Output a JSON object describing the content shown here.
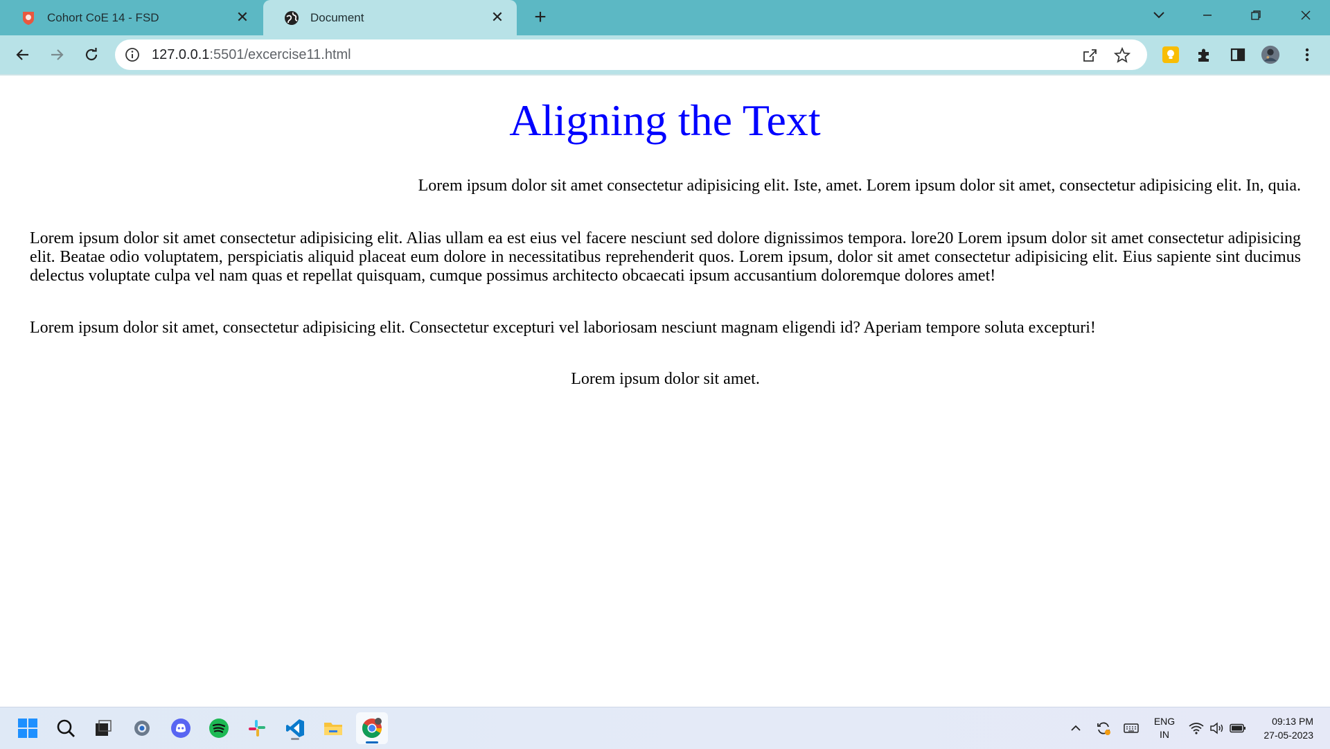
{
  "browser": {
    "tabs": [
      {
        "title": "Cohort CoE 14 - FSD",
        "favicon": "shield-favicon-icon",
        "active": false
      },
      {
        "title": "Document",
        "favicon": "globe-favicon-icon",
        "active": true
      }
    ],
    "new_tab_symbol": "+",
    "address": {
      "host": "127.0.0.1",
      "path": ":5501/excercise11.html"
    },
    "colors": {
      "tabstrip": "#5cb8c4",
      "toolbar": "#b8e2e7"
    }
  },
  "page": {
    "heading": "Aligning the Text",
    "heading_color": "#0000ff",
    "paragraphs": [
      {
        "align": "right",
        "text": "Lorem ipsum dolor sit amet consectetur adipisicing elit. Iste, amet. Lorem ipsum dolor sit amet, consectetur adipisicing elit. In, quia."
      },
      {
        "align": "justify",
        "text": "Lorem ipsum dolor sit amet consectetur adipisicing elit. Alias ullam ea est eius vel facere nesciunt sed dolore dignissimos tempora. lore20 Lorem ipsum dolor sit amet consectetur adipisicing elit. Beatae odio voluptatem, perspiciatis aliquid placeat eum dolore in necessitatibus reprehenderit quos. Lorem ipsum, dolor sit amet consectetur adipisicing elit. Eius sapiente sint ducimus delectus voluptate culpa vel nam quas et repellat quisquam, cumque possimus architecto obcaecati ipsum accusantium doloremque dolores amet!"
      },
      {
        "align": "left",
        "text": "Lorem ipsum dolor sit amet, consectetur adipisicing elit. Consectetur excepturi vel laboriosam nesciunt magnam eligendi id? Aperiam tempore soluta excepturi!"
      },
      {
        "align": "center",
        "text": "Lorem ipsum dolor sit amet."
      }
    ]
  },
  "taskbar": {
    "apps": [
      "windows-start-icon",
      "search-icon",
      "task-view-icon",
      "settings-icon",
      "discord-icon",
      "spotify-icon",
      "slack-icon",
      "vscode-icon",
      "file-explorer-icon",
      "chrome-icon"
    ],
    "tray": {
      "language_top": "ENG",
      "language_bottom": "IN"
    },
    "clock": {
      "time": "09:13 PM",
      "date": "27-05-2023"
    }
  }
}
